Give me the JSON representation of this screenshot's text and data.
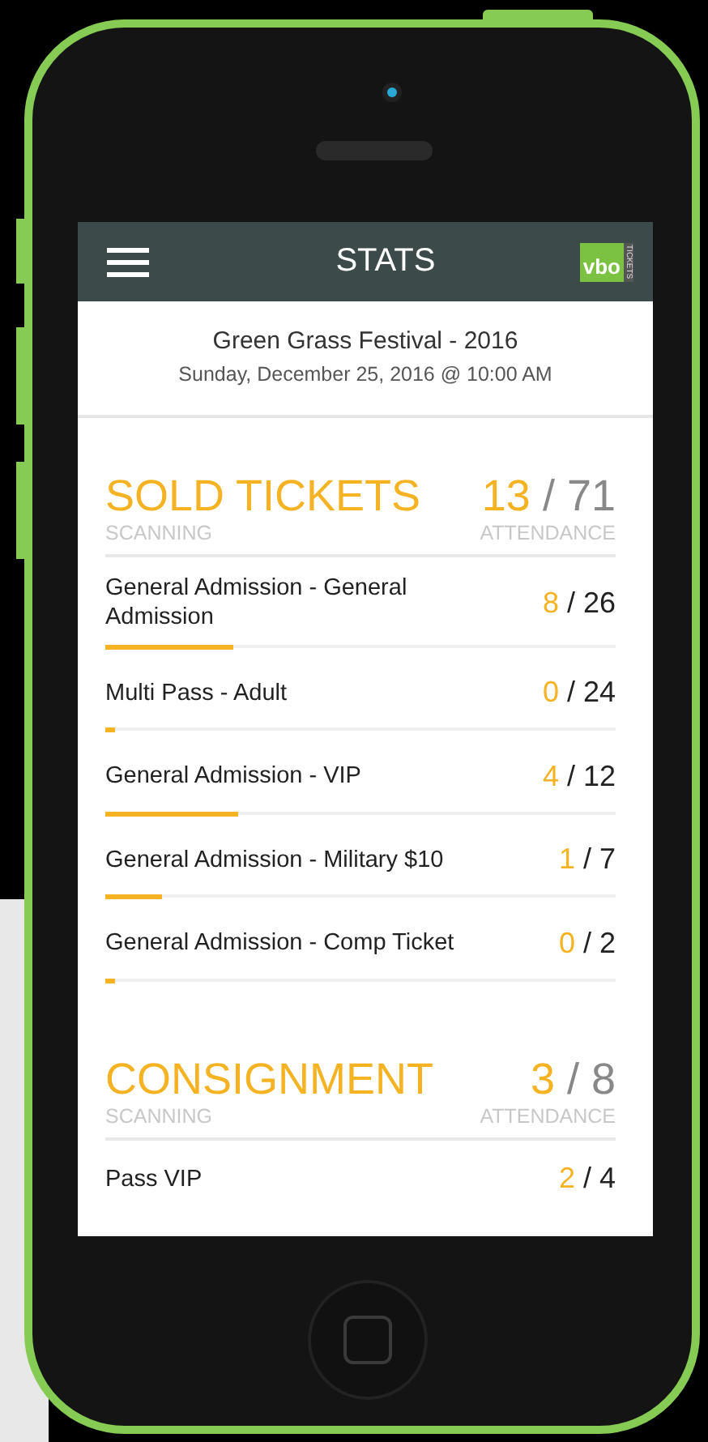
{
  "header": {
    "title": "STATS",
    "logo_text": "vbo",
    "logo_subtext": "TICKETS"
  },
  "event": {
    "name": "Green Grass Festival - 2016",
    "date": "Sunday, December 25, 2016 @ 10:00 AM"
  },
  "sections": [
    {
      "title": "SOLD TICKETS",
      "scanned": "13",
      "total": "/ 71",
      "left_label": "SCANNING",
      "right_label": "ATTENDANCE",
      "items": [
        {
          "name": "General Admission - General Admission",
          "scanned": "8",
          "total": "/ 26",
          "level": 0.25
        },
        {
          "name": "Multi Pass - Adult",
          "scanned": "0",
          "total": "/ 24",
          "level": 0.02
        },
        {
          "name": "General Admission - VIP",
          "scanned": "4",
          "total": "/ 12",
          "level": 0.26
        },
        {
          "name": "General Admission - Military $10",
          "scanned": "1",
          "total": "/ 7",
          "level": 0.11
        },
        {
          "name": "General Admission - Comp Ticket",
          "scanned": "0",
          "total": "/ 2",
          "level": 0.02
        }
      ]
    },
    {
      "title": "CONSIGNMENT",
      "scanned": "3",
      "total": "/ 8",
      "left_label": "SCANNING",
      "right_label": "ATTENDANCE",
      "items": [
        {
          "name": "Pass VIP",
          "scanned": "2",
          "total": "/ 4"
        }
      ]
    }
  ]
}
